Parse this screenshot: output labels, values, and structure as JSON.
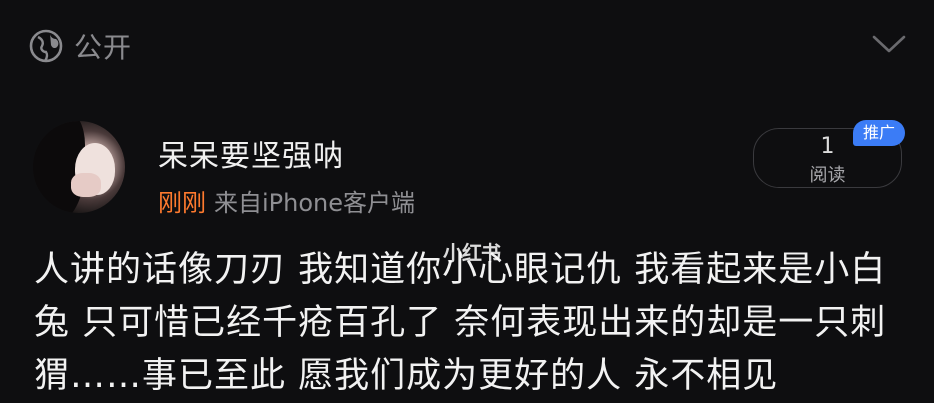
{
  "header": {
    "visibility_label": "公开",
    "visibility_icon": "globe-icon",
    "expand_icon": "chevron-down-icon"
  },
  "post": {
    "username": "呆呆要坚强呐",
    "time": "刚刚",
    "source": "来自iPhone客户端",
    "read_count": "1",
    "read_label": "阅读",
    "promote_label": "推广",
    "body_lines": [
      "人讲的话像刀刃 我知道你小心眼记仇 我看起来是小白",
      "兔 只可惜已经千疮百孔了 奈何表现出来的却是一只刺",
      "猬……事已至此 愿我们成为更好的人 永不相见"
    ],
    "watermark": "小红书"
  },
  "colors": {
    "background": "#0e0e10",
    "time_accent": "#ff7a2e",
    "promote_badge": "#3b7cf6"
  }
}
